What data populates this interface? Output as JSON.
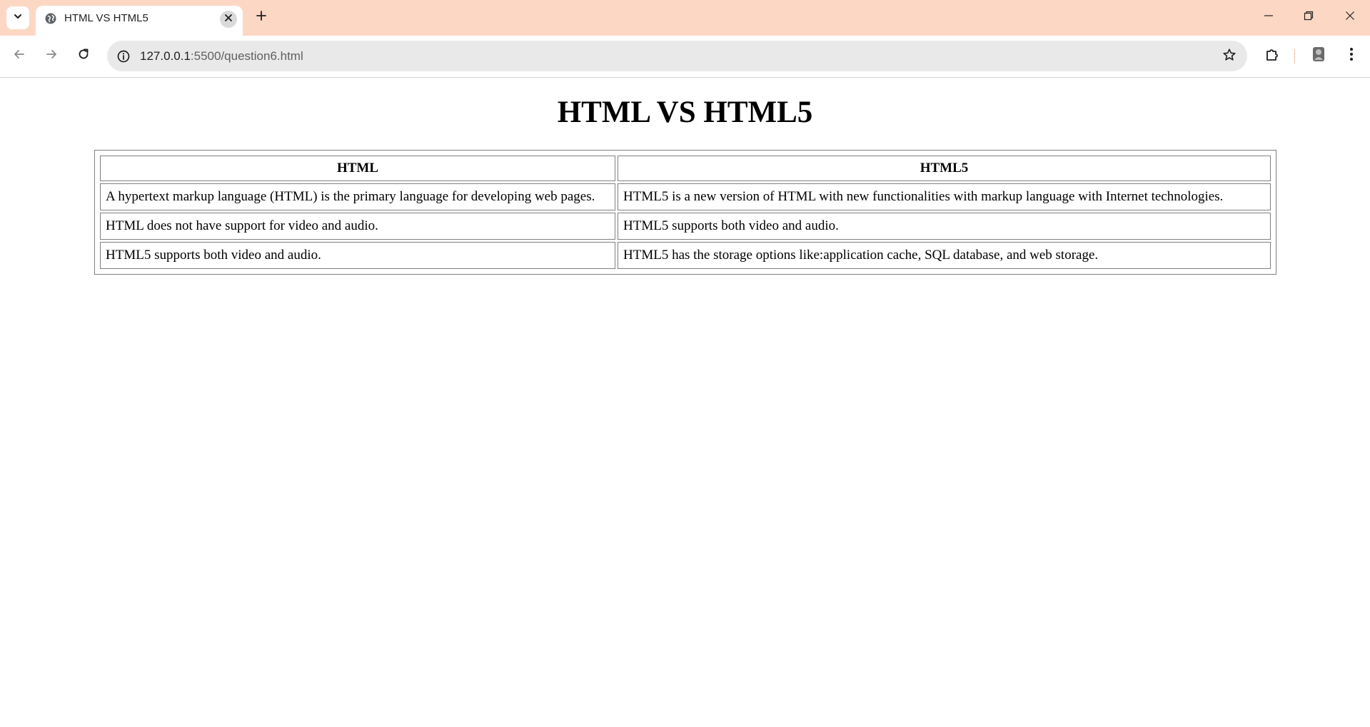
{
  "browser": {
    "tab": {
      "title": "HTML VS HTML5"
    },
    "address_bar": {
      "host": "127.0.0.1",
      "path": ":5500/question6.html"
    },
    "icons": {
      "tab_list": "chevron-down-icon",
      "favicon": "globe-icon",
      "tab_close": "close-icon",
      "new_tab": "plus-icon",
      "minimize": "minimize-icon",
      "restore": "restore-icon",
      "close_window": "close-icon",
      "back": "back-arrow-icon",
      "forward": "forward-arrow-icon",
      "reload": "reload-icon",
      "site_info": "info-icon",
      "bookmark": "star-icon",
      "extensions": "puzzle-icon",
      "profile": "profile-icon",
      "menu": "kebab-menu-icon"
    },
    "colors": {
      "tab_strip": "#fcd8c4",
      "omnibox": "#e9e9e9"
    }
  },
  "page": {
    "title": "HTML VS HTML5",
    "table": {
      "headers": [
        "HTML",
        "HTML5"
      ],
      "rows": [
        [
          "A hypertext markup language (HTML) is the primary language for developing web pages.",
          "HTML5 is a new version of HTML with new functionalities with markup language with Internet technologies."
        ],
        [
          "HTML does not have support for video and audio.",
          "HTML5 supports both video and audio."
        ],
        [
          "HTML5 supports both video and audio.",
          "HTML5 has the storage options like:application cache, SQL database, and web storage."
        ]
      ]
    }
  }
}
